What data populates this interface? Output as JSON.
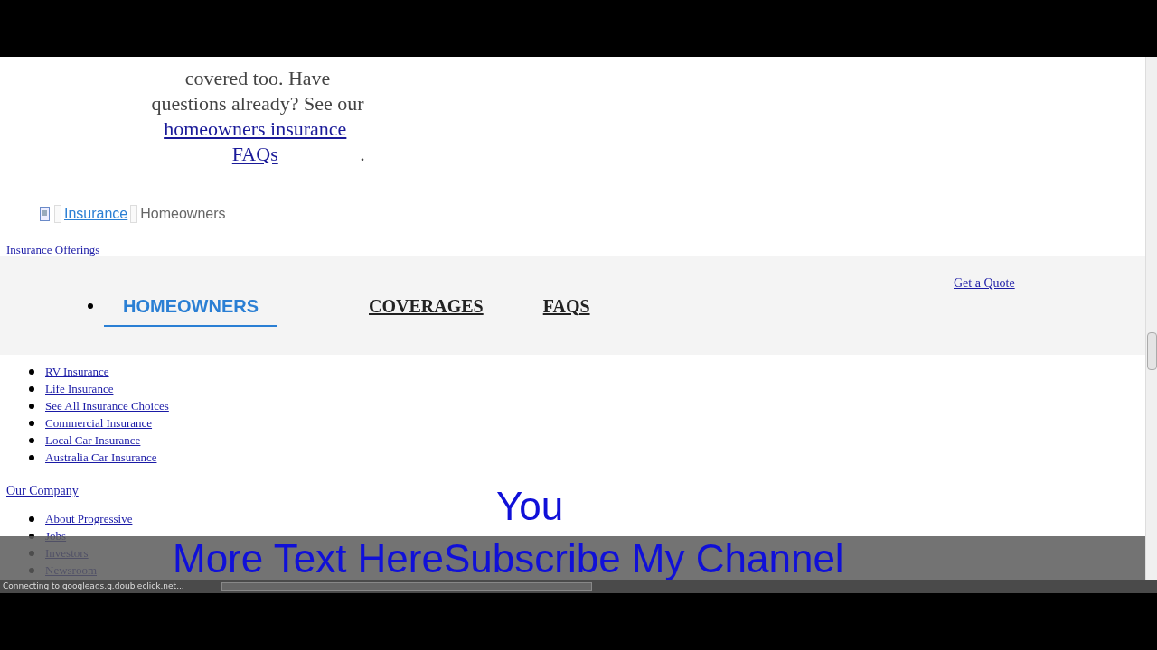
{
  "article": {
    "lines_before_link": [
      "covered too. Have",
      "questions already? See our"
    ],
    "link": "homeowners insurance FAQs",
    "after_link": "."
  },
  "breadcrumb": [
    {
      "text": "Insurance",
      "kind": "link"
    },
    {
      "text": "Homeowners",
      "kind": "current"
    }
  ],
  "offerings_heading": "Insurance Offerings",
  "tab_bar": {
    "tabs": [
      {
        "label": "HOMEOWNERS",
        "selected": true
      },
      {
        "label": "COVERAGES",
        "selected": false
      },
      {
        "label": "FAQS",
        "selected": false
      }
    ],
    "quote_link": "Get a Quote"
  },
  "offerings_links": [
    "RV Insurance",
    "Life Insurance",
    "See All Insurance Choices",
    "Commercial Insurance",
    "Local Car Insurance",
    "Australia Car Insurance"
  ],
  "company_heading": "Our Company",
  "company_links": [
    "About Progressive",
    "Jobs",
    "Investors",
    "Newsroom"
  ],
  "video_overlay": {
    "line_1": "You",
    "line_2": "More Text HereSubscribe My Channel"
  },
  "status_bar": {
    "text": "Connecting to googleads.g.doubleclick.net..."
  }
}
